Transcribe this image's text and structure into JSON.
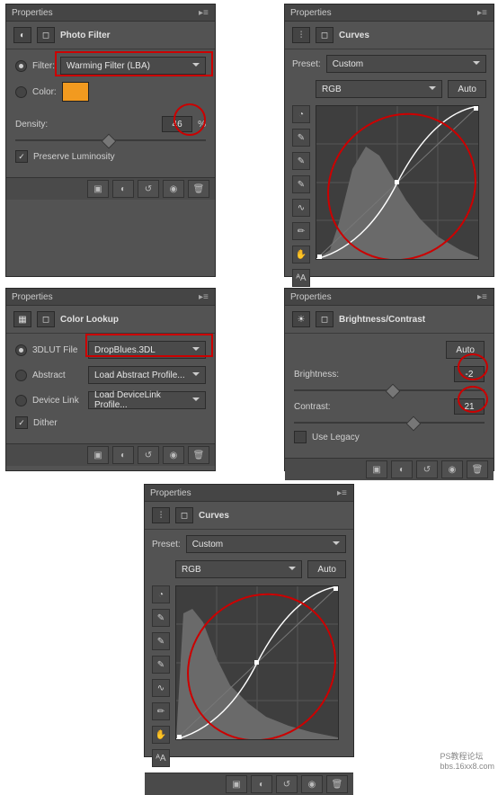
{
  "photoFilter": {
    "panelTitle": "Properties",
    "title": "Photo Filter",
    "filterLabel": "Filter:",
    "filterValue": "Warming Filter (LBA)",
    "colorLabel": "Color:",
    "colorHex": "#f29a1f",
    "densityLabel": "Density:",
    "densityValue": "46",
    "densityPct": "%",
    "preserveLabel": "Preserve Luminosity",
    "preserveChecked": true
  },
  "curves1": {
    "panelTitle": "Properties",
    "title": "Curves",
    "presetLabel": "Preset:",
    "presetValue": "Custom",
    "channel": "RGB",
    "autoLabel": "Auto"
  },
  "colorLookup": {
    "panelTitle": "Properties",
    "title": "Color Lookup",
    "lutLabel": "3DLUT File",
    "lutValue": "DropBlues.3DL",
    "abstractLabel": "Abstract",
    "abstractValue": "Load Abstract Profile...",
    "devLabel": "Device Link",
    "devValue": "Load DeviceLink Profile...",
    "ditherLabel": "Dither",
    "ditherChecked": true
  },
  "bc": {
    "panelTitle": "Properties",
    "title": "Brightness/Contrast",
    "autoLabel": "Auto",
    "brightnessLabel": "Brightness:",
    "brightnessValue": "-2",
    "contrastLabel": "Contrast:",
    "contrastValue": "21",
    "legacyLabel": "Use Legacy",
    "legacyChecked": false
  },
  "curves2": {
    "panelTitle": "Properties",
    "title": "Curves",
    "presetLabel": "Preset:",
    "presetValue": "Custom",
    "channel": "RGB",
    "autoLabel": "Auto"
  },
  "watermark": {
    "l1": "PS教程论坛",
    "l2": "bbs.16xx8.com"
  },
  "chart_data": [
    {
      "type": "line",
      "title": "Curves (top)",
      "xlim": [
        0,
        255
      ],
      "ylim": [
        0,
        255
      ],
      "series": [
        {
          "name": "RGB",
          "values": [
            [
              0,
              0
            ],
            [
              40,
              30
            ],
            [
              128,
              128
            ],
            [
              210,
              235
            ],
            [
              255,
              255
            ]
          ]
        }
      ]
    },
    {
      "type": "line",
      "title": "Curves (bottom)",
      "xlim": [
        0,
        255
      ],
      "ylim": [
        0,
        255
      ],
      "series": [
        {
          "name": "RGB",
          "values": [
            [
              0,
              0
            ],
            [
              45,
              25
            ],
            [
              128,
              128
            ],
            [
              205,
              232
            ],
            [
              255,
              255
            ]
          ]
        }
      ]
    }
  ]
}
